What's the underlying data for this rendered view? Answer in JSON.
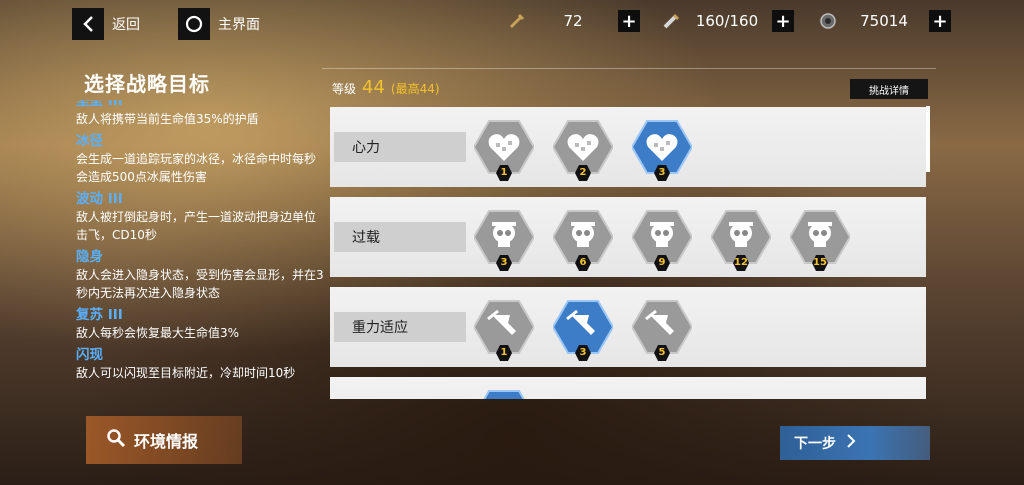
{
  "topbar": {
    "back_label": "返回",
    "home_label": "主界面",
    "resources": [
      {
        "icon": "stamina-icon",
        "value": "72"
      },
      {
        "icon": "ammo-icon",
        "value": "160/160"
      },
      {
        "icon": "coin-icon",
        "value": "75014"
      }
    ]
  },
  "left": {
    "title": "选择战略目标",
    "items": [
      {
        "name": "坚垒 III",
        "text": "敌人将携带当前生命值35%的护盾"
      },
      {
        "name": "冰径",
        "text": "会生成一道追踪玩家的冰径，冰径命中时每秒会造成500点冰属性伤害"
      },
      {
        "name": "波动 III",
        "text": "敌人被打倒起身时，产生一道波动把身边单位击飞，CD10秒"
      },
      {
        "name": "隐身",
        "text": "敌人会进入隐身状态，受到伤害会显形，并在3秒内无法再次进入隐身状态"
      },
      {
        "name": "复苏 III",
        "text": "敌人每秒会恢复最大生命值3%"
      },
      {
        "name": "闪现",
        "text": "敌人可以闪现至目标附近，冷却时间10秒"
      }
    ],
    "env_button": "环境情报"
  },
  "right": {
    "level_label": "等级",
    "level_value": "44",
    "level_max": "(最高44)",
    "detail_button": "挑战详情",
    "rows": [
      {
        "label": "心力",
        "icon": "heart-icon",
        "levels": [
          {
            "num": "1",
            "selected": false
          },
          {
            "num": "2",
            "selected": false
          },
          {
            "num": "3",
            "selected": true
          }
        ]
      },
      {
        "label": "过载",
        "icon": "skull-icon",
        "levels": [
          {
            "num": "3",
            "selected": false
          },
          {
            "num": "6",
            "selected": false
          },
          {
            "num": "9",
            "selected": false
          },
          {
            "num": "12",
            "selected": false
          },
          {
            "num": "15",
            "selected": false
          }
        ]
      },
      {
        "label": "重力适应",
        "icon": "boot-icon",
        "levels": [
          {
            "num": "1",
            "selected": false
          },
          {
            "num": "3",
            "selected": true
          },
          {
            "num": "5",
            "selected": false
          }
        ]
      },
      {
        "label": "",
        "icon": "hex-icon",
        "levels": [
          {
            "num": "",
            "selected": true
          }
        ]
      }
    ]
  },
  "next_button": "下一步",
  "colors": {
    "accent_blue": "#3d7dc8",
    "level_yellow": "#f2c12e",
    "hex_gray": "#9a9a9a"
  }
}
